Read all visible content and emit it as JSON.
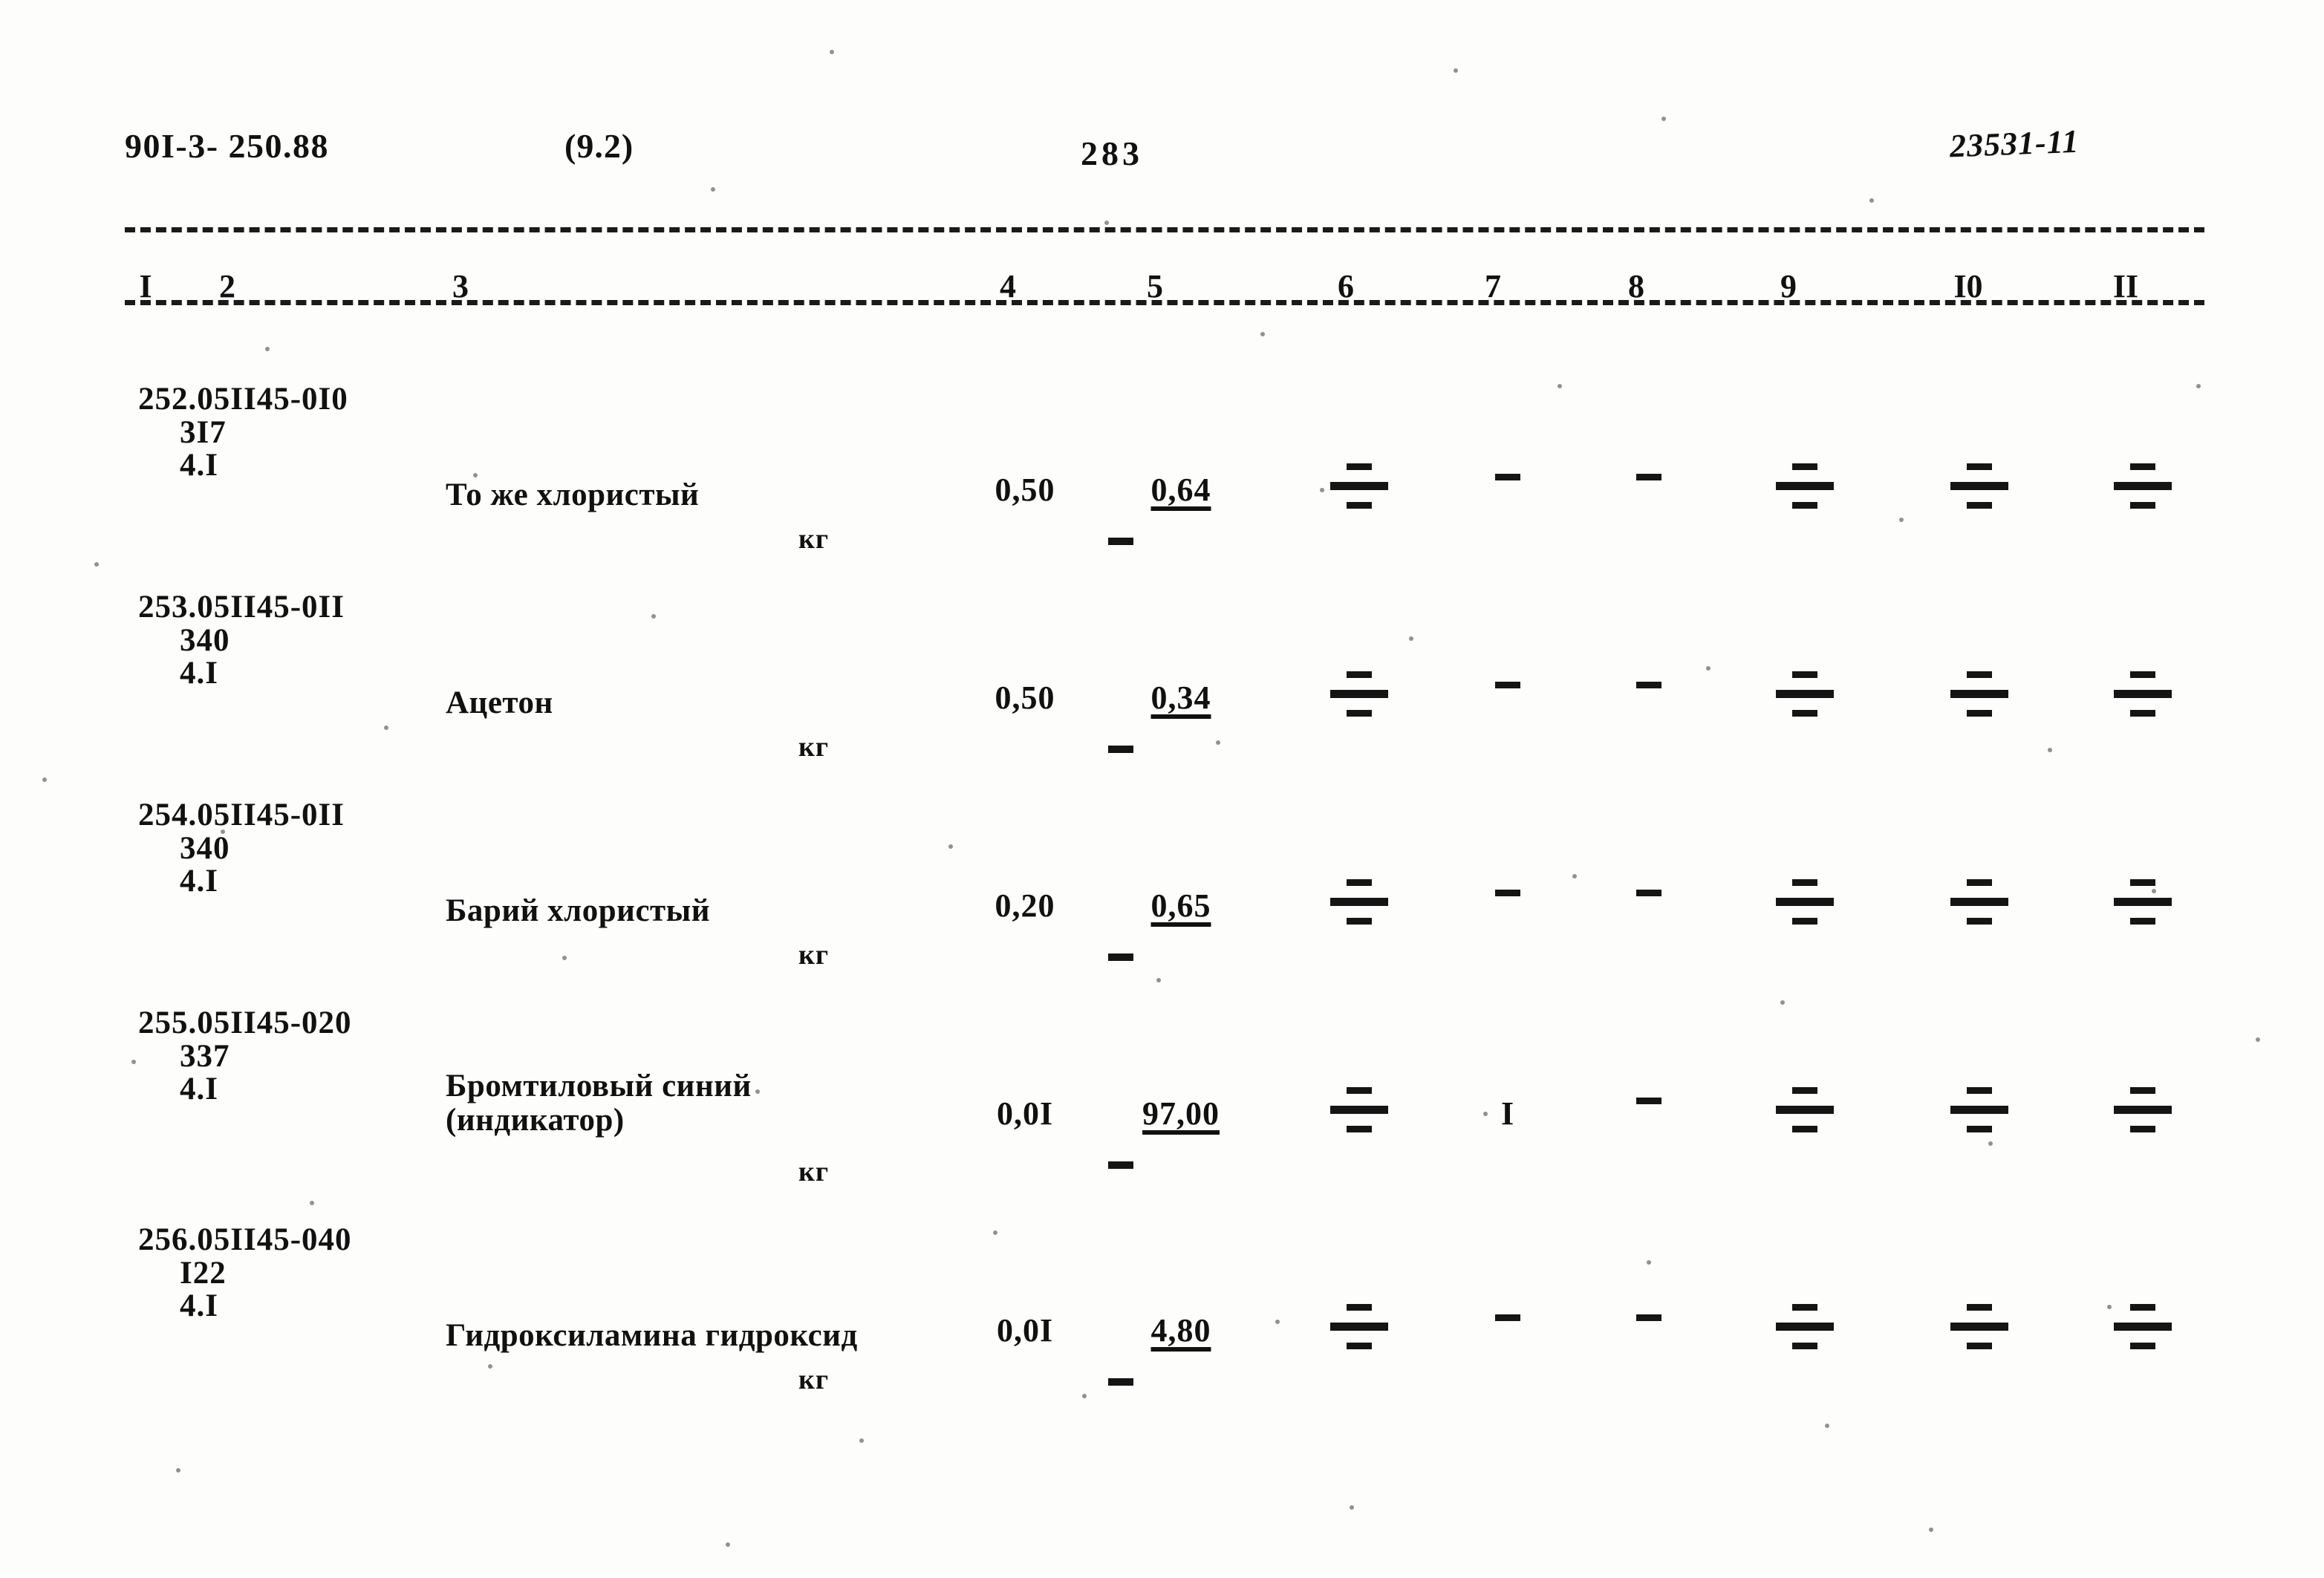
{
  "header": {
    "doc_code": "90I-3- 250.88",
    "variant": "(9.2)",
    "page_number": "283",
    "archive_code": "23531-11"
  },
  "table": {
    "column_numbers": [
      "I",
      "2",
      "3",
      "4",
      "5",
      "6",
      "7",
      "8",
      "9",
      "I0",
      "II"
    ],
    "rows": [
      {
        "code_line1": "252.05II45-0I0",
        "code_line2": "3I7",
        "code_line3": "4.I",
        "name_line1": "То же хлористый",
        "name_line2": "",
        "unit": "кг",
        "col4": "0,50",
        "col5": "0,64",
        "col6": "fraction",
        "col7": "dash",
        "col8": "dash",
        "col9": "fraction",
        "col10": "fraction",
        "col11": "fraction"
      },
      {
        "code_line1": "253.05II45-0II",
        "code_line2": "340",
        "code_line3": "4.I",
        "name_line1": "Ацетон",
        "name_line2": "",
        "unit": "кг",
        "col4": "0,50",
        "col5": "0,34",
        "col6": "fraction",
        "col7": "dash",
        "col8": "dash",
        "col9": "fraction",
        "col10": "fraction",
        "col11": "fraction"
      },
      {
        "code_line1": "254.05II45-0II",
        "code_line2": "340",
        "code_line3": "4.I",
        "name_line1": "Барий хлористый",
        "name_line2": "",
        "unit": "кг",
        "col4": "0,20",
        "col5": "0,65",
        "col6": "fraction",
        "col7": "dash",
        "col8": "dash",
        "col9": "fraction",
        "col10": "fraction",
        "col11": "fraction"
      },
      {
        "code_line1": "255.05II45-020",
        "code_line2": "337",
        "code_line3": "4.I",
        "name_line1": "Бромтиловый синий",
        "name_line2": "(индикатор)",
        "unit": "кг",
        "col4": "0,0I",
        "col5": "97,00",
        "col6": "fraction",
        "col7": "I",
        "col8": "dash",
        "col9": "fraction",
        "col10": "fraction",
        "col11": "fraction"
      },
      {
        "code_line1": "256.05II45-040",
        "code_line2": "I22",
        "code_line3": "4.I",
        "name_line1": "Гидроксиламина гидроксид",
        "name_line2": "",
        "unit": "кг",
        "col4": "0,0I",
        "col5": "4,80",
        "col6": "fraction",
        "col7": "dash",
        "col8": "dash",
        "col9": "fraction",
        "col10": "fraction",
        "col11": "fraction"
      }
    ]
  }
}
